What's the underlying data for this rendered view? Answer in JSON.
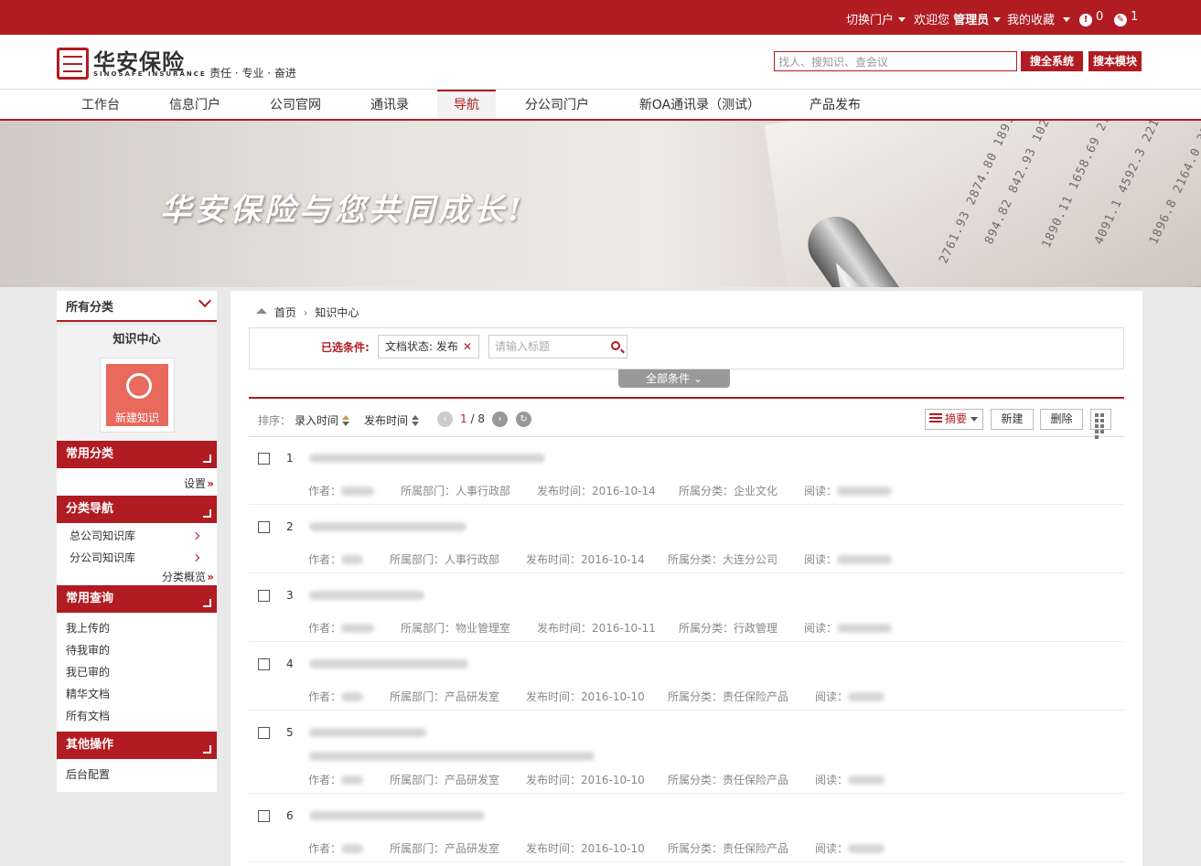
{
  "topbar": {
    "switch_portal": "切换门户",
    "welcome": "欢迎您",
    "username": "管理员",
    "favorites": "我的收藏",
    "alert_count": "0",
    "task_count": "1"
  },
  "header": {
    "logo_cn": "华安保险",
    "logo_en": "SINOSAFE INSURANCE",
    "slogan": "责任 · 专业 · 奋进",
    "search_placeholder": "找人、搜知识、查会议",
    "search_all": "搜全系统",
    "search_module": "搜本模块"
  },
  "nav": [
    {
      "label": "工作台"
    },
    {
      "label": "信息门户"
    },
    {
      "label": "公司官网"
    },
    {
      "label": "通讯录"
    },
    {
      "label": "导航",
      "active": true
    },
    {
      "label": "分公司门户"
    },
    {
      "label": "新OA通讯录（测试）"
    },
    {
      "label": "产品发布"
    }
  ],
  "banner": {
    "slogan": "华安保险与您共同成长!"
  },
  "sidebar": {
    "all_categories": "所有分类",
    "knowledge_center": "知识中心",
    "new_knowledge": "新建知识",
    "common_categories": "常用分类",
    "settings": "设置",
    "category_nav": "分类导航",
    "nav_items": [
      "总公司知识库",
      "分公司知识库"
    ],
    "category_overview": "分类概览",
    "common_query": "常用查询",
    "query_items": [
      "我上传的",
      "待我审的",
      "我已审的",
      "精华文档",
      "所有文档"
    ],
    "other_ops": "其他操作",
    "backend": "后台配置"
  },
  "main": {
    "breadcrumb_home": "首页",
    "breadcrumb_current": "知识中心",
    "selected_label": "已选条件:",
    "filter_tag": "文档状态: 发布",
    "title_placeholder": "请输入标题",
    "all_conditions": "全部条件",
    "sort_label": "排序：",
    "sort_entry": "录入时间",
    "sort_publish": "发布时间",
    "page_current": "1",
    "page_total": "8",
    "view_summary": "摘要",
    "new_button": "新建",
    "delete_button": "删除"
  },
  "labels": {
    "author": "作者：",
    "dept": "所属部门：",
    "pubtime": "发布时间：",
    "category": "所属分类：",
    "reads": "阅读："
  },
  "documents": [
    {
      "no": "1",
      "dept": "人事行政部",
      "date": "2016-10-14",
      "category": "企业文化"
    },
    {
      "no": "2",
      "dept": "人事行政部",
      "date": "2016-10-14",
      "category": "大连分公司"
    },
    {
      "no": "3",
      "dept": "物业管理室",
      "date": "2016-10-11",
      "category": "行政管理"
    },
    {
      "no": "4",
      "dept": "产品研发室",
      "date": "2016-10-10",
      "category": "责任保险产品"
    },
    {
      "no": "5",
      "dept": "产品研发室",
      "date": "2016-10-10",
      "category": "责任保险产品"
    },
    {
      "no": "6",
      "dept": "产品研发室",
      "date": "2016-10-10",
      "category": "责任保险产品"
    }
  ],
  "colors": {
    "brand": "#b01c22",
    "icon_tile": "#e9695c"
  }
}
